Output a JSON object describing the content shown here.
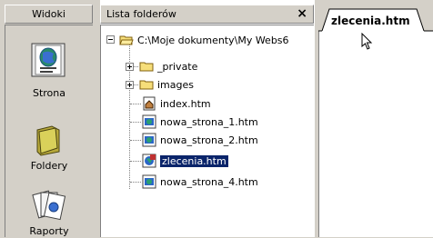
{
  "views": {
    "header": "Widoki",
    "items": [
      {
        "label": "Strona",
        "icon": "page-view-icon"
      },
      {
        "label": "Foldery",
        "icon": "folder-view-icon"
      },
      {
        "label": "Raporty",
        "icon": "reports-view-icon"
      }
    ]
  },
  "folder_list": {
    "title": "Lista folderów",
    "close_glyph": "×",
    "root": "C:\\Moje dokumenty\\My Webs6",
    "items": [
      {
        "label": "_private",
        "type": "folder"
      },
      {
        "label": "images",
        "type": "folder"
      },
      {
        "label": "index.htm",
        "type": "home-page"
      },
      {
        "label": "nowa_strona_1.htm",
        "type": "page"
      },
      {
        "label": "nowa_strona_2.htm",
        "type": "page"
      },
      {
        "label": "zlecenia.htm",
        "type": "page-selected"
      },
      {
        "label": "nowa_strona_4.htm",
        "type": "page"
      }
    ]
  },
  "editor": {
    "tab_label": "zlecenia.htm"
  },
  "colors": {
    "chrome": "#d4d0c8",
    "selection": "#0a246a",
    "folder_yellow": "#f6de7a"
  }
}
